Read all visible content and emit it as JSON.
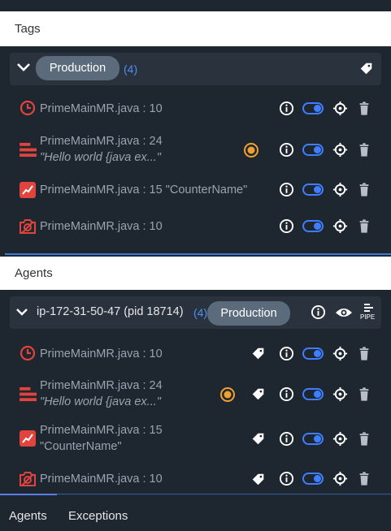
{
  "tags_section": {
    "title": "Tags",
    "group": {
      "label": "Production",
      "count": "(4)"
    },
    "rows": [
      {
        "file": "PrimeMainMR.java : 10",
        "icon": "clock-icon"
      },
      {
        "file": "PrimeMainMR.java : 24",
        "sub": "\"Hello world {java ex...\"",
        "icon": "log-icon"
      },
      {
        "file": "PrimeMainMR.java : 15 \"CounterName\"",
        "icon": "counter-icon"
      },
      {
        "file": "PrimeMainMR.java : 10",
        "icon": "snapshot-icon"
      }
    ]
  },
  "agents_section": {
    "title": "Agents",
    "group": {
      "label": "ip-172-31-50-47 (pid 18714)",
      "count": "(4)",
      "badge": "Production",
      "pipe_label": "PIPE"
    },
    "rows": [
      {
        "file": "PrimeMainMR.java : 10",
        "icon": "clock-icon"
      },
      {
        "file": "PrimeMainMR.java : 24",
        "sub": "\"Hello world {java ex...\"",
        "icon": "log-icon"
      },
      {
        "file": "PrimeMainMR.java : 15",
        "sub2": "\"CounterName\"",
        "icon": "counter-icon"
      },
      {
        "file": "PrimeMainMR.java : 10",
        "icon": "snapshot-icon"
      }
    ]
  },
  "bottom_tabs": [
    {
      "label": "Agents",
      "active": true
    },
    {
      "label": "Exceptions",
      "active": false
    }
  ],
  "colors": {
    "accent_blue": "#3f7fff",
    "icon_red": "#e0443c",
    "warning_orange": "#f0a030"
  }
}
